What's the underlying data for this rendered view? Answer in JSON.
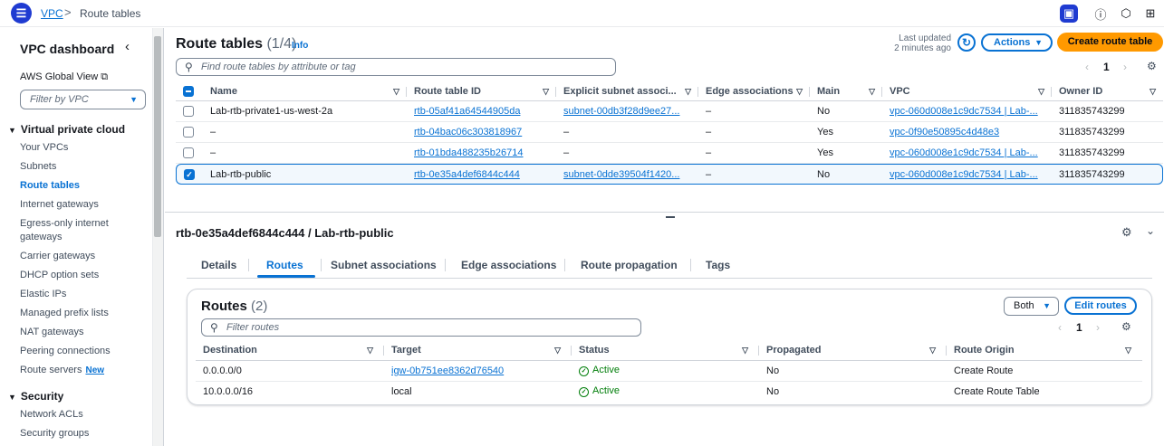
{
  "topbar": {
    "breadcrumb_service": "VPC",
    "breadcrumb_separator": ">",
    "breadcrumb_current": "Route tables",
    "icons": [
      "menu-icon",
      "panel-icon",
      "info-icon",
      "settings-icon",
      "feedback-icon"
    ]
  },
  "sidebar": {
    "title": "VPC dashboard",
    "global_view": "AWS Global View",
    "filter_placeholder": "Filter by VPC",
    "sections": [
      {
        "title": "Virtual private cloud",
        "items": [
          "Your VPCs",
          "Subnets",
          "Route tables",
          "Internet gateways",
          "Egress-only internet gateways",
          "Carrier gateways",
          "DHCP option sets",
          "Elastic IPs",
          "Managed prefix lists",
          "NAT gateways",
          "Peering connections",
          "Route servers"
        ]
      },
      {
        "title": "Security",
        "items": [
          "Network ACLs",
          "Security groups"
        ]
      }
    ],
    "active_item": "Route tables",
    "new_badge": "New"
  },
  "route_tables": {
    "title": "Route tables",
    "count": "(1/4)",
    "info": "Info",
    "last_updated_line1": "Last updated",
    "last_updated_line2": "2 minutes ago",
    "actions_label": "Actions",
    "create_label": "Create route table",
    "search_placeholder": "Find route tables by attribute or tag",
    "page": "1",
    "columns": [
      "Name",
      "Route table ID",
      "Explicit subnet associ...",
      "Edge associations",
      "Main",
      "VPC",
      "Owner ID"
    ],
    "rows": [
      {
        "selected": false,
        "name": "Lab-rtb-private1-us-west-2a",
        "id": "rtb-05af41a64544905da",
        "subnet": "subnet-00db3f28d9ee27...",
        "edge": "–",
        "main": "No",
        "vpc": "vpc-060d008e1c9dc7534 | Lab-...",
        "owner": "311835743299"
      },
      {
        "selected": false,
        "name": "–",
        "id": "rtb-04bac06c303818967",
        "subnet": "–",
        "edge": "–",
        "main": "Yes",
        "vpc": "vpc-0f90e50895c4d48e3",
        "owner": "311835743299"
      },
      {
        "selected": false,
        "name": "–",
        "id": "rtb-01bda488235b26714",
        "subnet": "–",
        "edge": "–",
        "main": "Yes",
        "vpc": "vpc-060d008e1c9dc7534 | Lab-...",
        "owner": "311835743299"
      },
      {
        "selected": true,
        "name": "Lab-rtb-public",
        "id": "rtb-0e35a4def6844c444",
        "subnet": "subnet-0dde39504f1420...",
        "edge": "–",
        "main": "No",
        "vpc": "vpc-060d008e1c9dc7534 | Lab-...",
        "owner": "311835743299"
      }
    ]
  },
  "detail": {
    "title": "rtb-0e35a4def6844c444 / Lab-rtb-public",
    "tabs": [
      "Details",
      "Routes",
      "Subnet associations",
      "Edge associations",
      "Route propagation",
      "Tags"
    ],
    "active_tab": "Routes",
    "routes": {
      "title": "Routes",
      "count": "(2)",
      "filter_value": "Both",
      "edit_label": "Edit routes",
      "search_placeholder": "Filter routes",
      "page": "1",
      "columns": [
        "Destination",
        "Target",
        "Status",
        "Propagated",
        "Route Origin"
      ],
      "rows": [
        {
          "destination": "0.0.0.0/0",
          "target": "igw-0b751ee8362d76540",
          "status": "Active",
          "propagated": "No",
          "origin": "Create Route"
        },
        {
          "destination": "10.0.0.0/16",
          "target": "local",
          "status": "Active",
          "propagated": "No",
          "origin": "Create Route Table"
        }
      ]
    }
  }
}
